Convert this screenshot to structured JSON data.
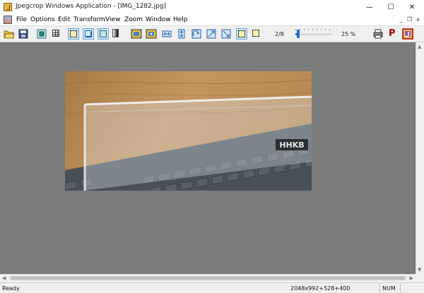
{
  "window": {
    "title": "Jpegcrop Windows Application - [IMG_1282.jpg]",
    "controls": {
      "minimize": "—",
      "maximize": "☐",
      "close": "✕"
    }
  },
  "menubar": {
    "items": [
      {
        "label": "File"
      },
      {
        "label": "Options"
      },
      {
        "label": "Edit"
      },
      {
        "label": "Transform"
      },
      {
        "label": "View"
      },
      {
        "label": "Zoom"
      },
      {
        "label": "Window"
      },
      {
        "label": "Help"
      }
    ],
    "mdi_controls": {
      "minimize": "_",
      "restore": "❐",
      "close": "x"
    }
  },
  "toolbar": {
    "page_indicator": "2/8",
    "zoom_percent": "25 %",
    "zoom_level": 0.25,
    "print_icon": "printer-icon",
    "properties_glyph": "P",
    "about_icon": "jpegcrop-about-icon"
  },
  "image": {
    "keyboard_brand": "HHKB"
  },
  "statusbar": {
    "status": "Ready",
    "dimensions": "2048x992+528+400",
    "num_lock": "NUM"
  },
  "colors": {
    "workspace_bg": "#7b7b7b",
    "pressed_button": "#cce4f7",
    "slider_accent": "#1e6fd0"
  }
}
